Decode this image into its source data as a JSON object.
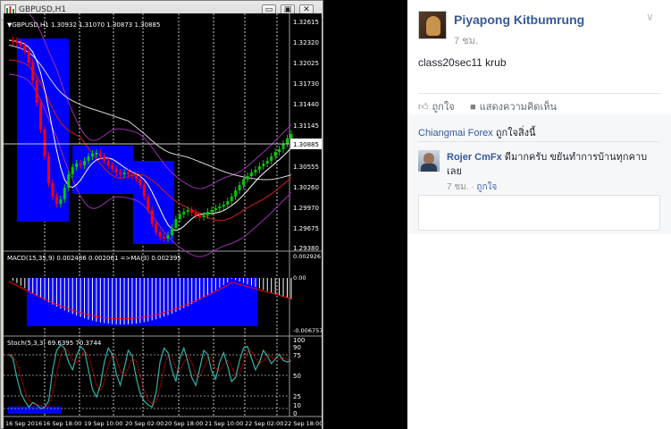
{
  "terminal": {
    "window_title": "GBPUSD,H1",
    "buttons": {
      "minimize": "▭",
      "restore": "▣",
      "close": "✕"
    },
    "price_panel": {
      "header": "▼GBPUSD,H1  1.30932 1.31070 1.30873 1.30885",
      "price_labels": [
        "1.32615",
        "1.32320",
        "1.32025",
        "1.31730",
        "1.31440",
        "1.31145",
        "1.30885",
        "1.30555",
        "1.30260",
        "1.29970",
        "1.29675",
        "1.29380"
      ],
      "current_price": "1.30885"
    },
    "macd_panel": {
      "header": "MACD(15,35,9) 0.002486 0.002061  =>MA(3) 0.002395",
      "labels": [
        "0.002926",
        "0.00",
        "-0.006757"
      ]
    },
    "stoch_panel": {
      "header": "Stoch(5,3,3) 69.6395 70.3744",
      "labels": [
        "100",
        "90",
        "75",
        "50",
        "25",
        "10",
        "0"
      ]
    },
    "time_axis": [
      "16 Sep 2016",
      "16 Sep 18:00",
      "19 Sep 10:00",
      "20 Sep 02:00",
      "20 Sep 18:00",
      "21 Sep 10:00",
      "22 Sep 02:00",
      "22 Sep 18:00"
    ],
    "colors": {
      "background": "#000000",
      "bull_candle": "#00c800",
      "bear_candle": "#ff0000",
      "box": "#0000ff",
      "ma_fast": "#ffffff",
      "ma_slow": "#d8d8d8",
      "envelope": "#9b2fae",
      "ma_red": "#b91b1b",
      "macd_hist": "#ffffff",
      "stoch_main": "#2fb5a8",
      "stoch_signal": "#ff0000"
    }
  },
  "post": {
    "author": "Piyapong Kitbumrung",
    "time": "7 ชม.",
    "text": "class20sec11 krub",
    "actions": {
      "like": "ถูกใจ",
      "comment": "แสดงความคิดเห็น"
    },
    "likes": {
      "liker": "Chiangmai Forex",
      "suffix": " ถูกใจสิ่งนี้"
    },
    "comment": {
      "name": "Rojer CmFx",
      "text": " ดีมากครับ ขยันทำการบ้านทุกคาบเลย",
      "time": "7 ชม.",
      "like": "ถูกใจ"
    }
  }
}
